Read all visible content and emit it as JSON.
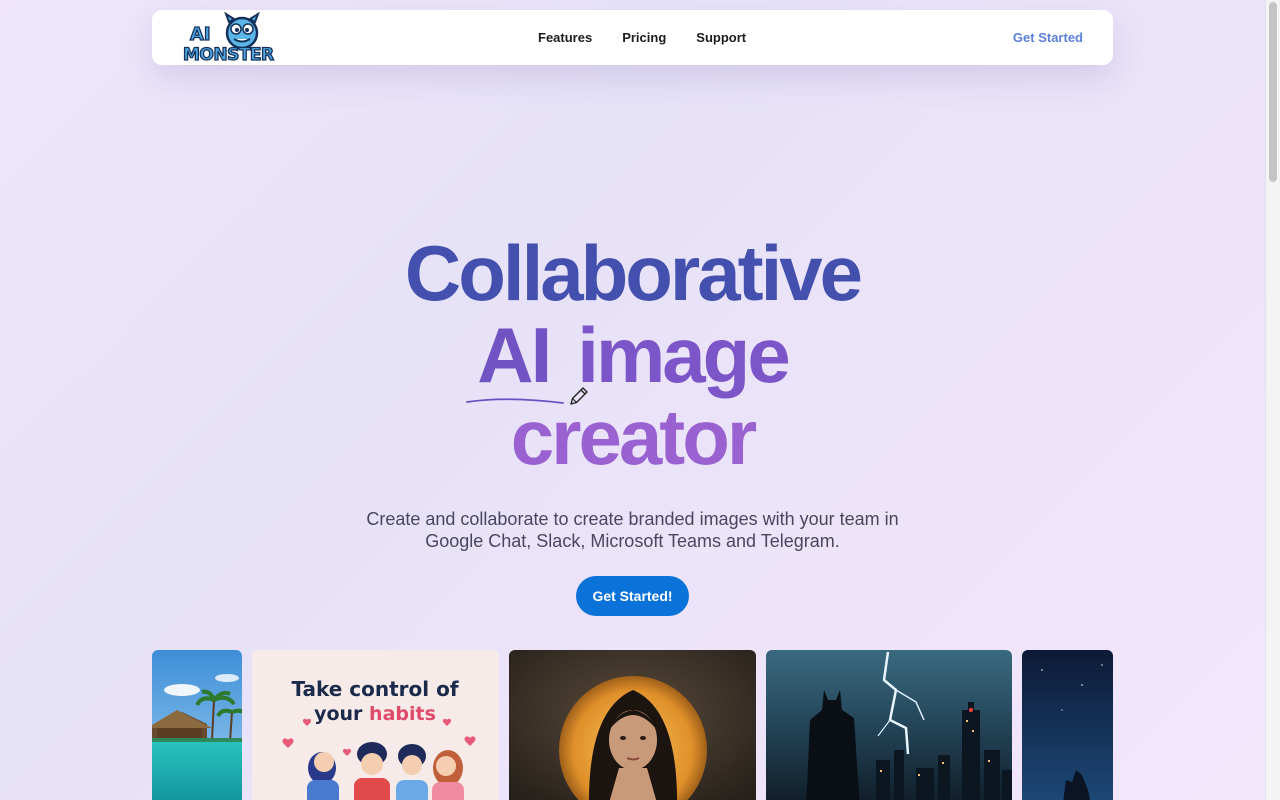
{
  "nav": {
    "logo_text_1": "AI",
    "logo_text_2": "MONSTER",
    "links": [
      "Features",
      "Pricing",
      "Support"
    ],
    "cta": "Get Started"
  },
  "hero": {
    "line1": "Collaborative",
    "line2a": "AI",
    "line2b": "image",
    "line3": "creator",
    "subtitle_line1": "Create and collaborate to create branded images with your team in",
    "subtitle_line2": "Google Chat, Slack, Microsoft Teams and Telegram.",
    "cta": "Get Started!"
  },
  "gallery": {
    "card2_line1": "Take control of",
    "card2_line2a": "your",
    "card2_line2b": "habits",
    "items": [
      "tropical-beach-image",
      "habits-illustration-image",
      "woman-portrait-image",
      "batman-lightning-image",
      "night-sky-image"
    ]
  },
  "colors": {
    "accent_blue": "#0a72d9",
    "nav_cta": "#5b82d9",
    "title_blue": "#4450ae",
    "title_purple": "#9a62d1"
  }
}
